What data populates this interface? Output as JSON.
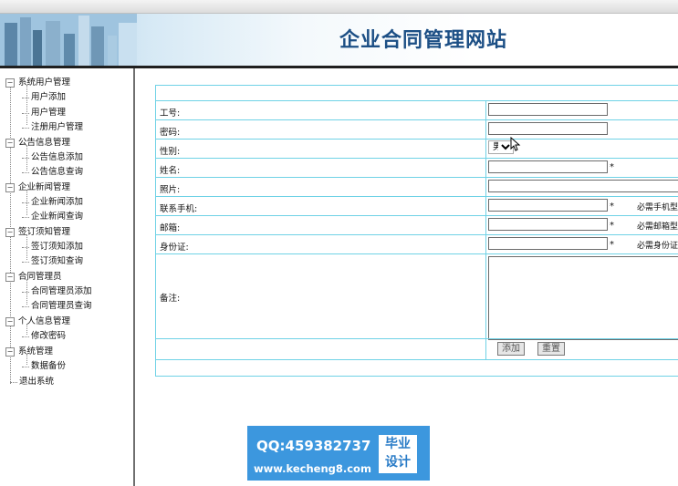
{
  "app": {
    "site_title": "企业合同管理网站"
  },
  "sidebar": {
    "groups": [
      {
        "label": "系统用户管理",
        "children": [
          "用户添加",
          "用户管理",
          "注册用户管理"
        ]
      },
      {
        "label": "公告信息管理",
        "children": [
          "公告信息添加",
          "公告信息查询"
        ]
      },
      {
        "label": "企业新闻管理",
        "children": [
          "企业新闻添加",
          "企业新闻查询"
        ]
      },
      {
        "label": "签订须知管理",
        "children": [
          "签订须知添加",
          "签订须知查询"
        ]
      },
      {
        "label": "合同管理员",
        "children": [
          "合同管理员添加",
          "合同管理员查询"
        ]
      },
      {
        "label": "个人信息管理",
        "children": [
          "修改密码"
        ]
      },
      {
        "label": "系统管理",
        "children": [
          "数据备份"
        ]
      }
    ],
    "logout": "退出系统"
  },
  "form": {
    "labels": {
      "id": "工号:",
      "password": "密码:",
      "gender": "性别:",
      "name": "姓名:",
      "photo": "照片:",
      "phone": "联系手机:",
      "email": "邮箱:",
      "idcard": "身份证:",
      "remark": "备注:"
    },
    "required_mark": "*",
    "gender_selected": "男",
    "hints": {
      "phone": "必需手机型",
      "email": "必需邮箱型",
      "idcard": "必需身份证"
    },
    "buttons": {
      "add": "添加",
      "reset": "重置"
    }
  },
  "watermark": {
    "qq": "QQ:459382737",
    "url": "www.kecheng8.com",
    "badge_line1": "毕业",
    "badge_line2": "设计"
  }
}
